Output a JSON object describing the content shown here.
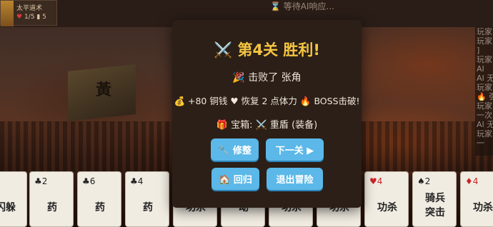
{
  "scene": {
    "flag_char": "黃"
  },
  "player": {
    "name": "太平道术",
    "hp": "1/5",
    "cards": "5"
  },
  "status": {
    "waiting": "⌛ 等待AI响应..."
  },
  "log": {
    "lines": [
      "玩家",
      "玩家",
      "]",
      "玩家",
      "AI",
      "AI 无",
      "玩家",
      "🔥 强",
      "玩家",
      "一次",
      "AI 无",
      "玩家",
      "一"
    ]
  },
  "modal": {
    "title": "⚔️ 第4关 胜利!",
    "defeated": "🎉 击败了 张角",
    "rewards": {
      "coins": "💰 +80 铜钱",
      "heal": "♥ 恢复 2 点体力",
      "boss": "🔥 BOSS击破!"
    },
    "chest": "🎁 宝箱: ⚔️ 重盾 (装备)",
    "buttons": {
      "repair": "🔧 修整",
      "next": "下一关 ▶",
      "return": "🏠 回归",
      "exit": "退出冒险"
    }
  },
  "hand": [
    {
      "suit": "",
      "name": "闪躲"
    },
    {
      "suit": "♣2",
      "name": "药"
    },
    {
      "suit": "♣6",
      "name": "药"
    },
    {
      "suit": "♣4",
      "name": "药"
    },
    {
      "suit": "",
      "name": "功杀"
    },
    {
      "suit": "",
      "name": "动"
    },
    {
      "suit": "",
      "name": "功杀"
    },
    {
      "suit": "",
      "name": "功杀"
    },
    {
      "suit": "♥4",
      "name": "功杀"
    },
    {
      "suit": "♠2",
      "name": "骑兵突击"
    },
    {
      "suit": "♦4",
      "name": "功杀"
    }
  ],
  "colors": {
    "accent_gold": "#f4c542",
    "button_blue": "#5bb8e8",
    "modal_bg": "#2b1f18"
  }
}
